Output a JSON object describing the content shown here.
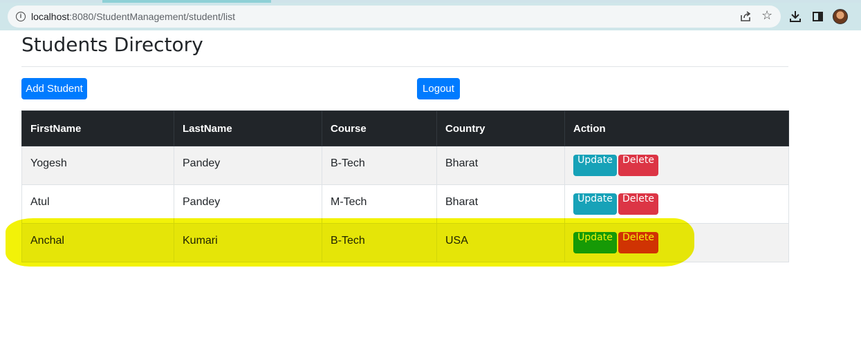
{
  "browser": {
    "url_host": "localhost",
    "url_path": ":8080/StudentManagement/student/list"
  },
  "page": {
    "title": "Students Directory",
    "add_button": "Add Student",
    "logout_button": "Logout"
  },
  "table": {
    "headers": [
      "FirstName",
      "LastName",
      "Course",
      "Country",
      "Action"
    ],
    "rows": [
      {
        "first": "Yogesh",
        "last": "Pandey",
        "course": "B-Tech",
        "country": "Bharat"
      },
      {
        "first": "Atul",
        "last": "Pandey",
        "course": "M-Tech",
        "country": "Bharat"
      },
      {
        "first": "Anchal",
        "last": "Kumari",
        "course": "B-Tech",
        "country": "USA"
      }
    ],
    "update_label": "Update",
    "delete_label": "Delete"
  },
  "colors": {
    "primary": "#007bff",
    "info": "#17a2b8",
    "danger": "#dc3545",
    "header_dark": "#212529",
    "highlight": "#f2f200"
  }
}
